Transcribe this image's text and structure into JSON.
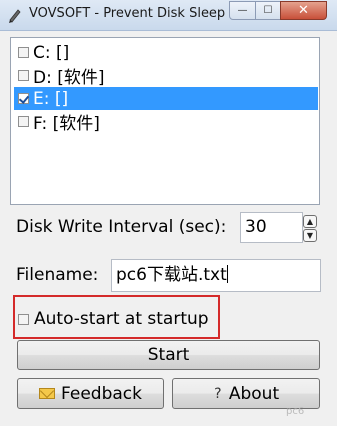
{
  "window": {
    "title": "VOVSOFT - Prevent Disk Sleep"
  },
  "title_controls": {
    "minimize": "—",
    "maximize": "☐",
    "close": "✕"
  },
  "drives": [
    {
      "label": "C: []",
      "checked": false,
      "selected": false
    },
    {
      "label": "D: [软件]",
      "checked": false,
      "selected": false
    },
    {
      "label": "E: []",
      "checked": true,
      "selected": true
    },
    {
      "label": "F: [软件]",
      "checked": false,
      "selected": false
    }
  ],
  "interval": {
    "label": "Disk Write Interval (sec):",
    "value": "30",
    "up": "▲",
    "down": "▼"
  },
  "filename": {
    "label": "Filename:",
    "value": "pc6下载站.txt"
  },
  "autostart": {
    "label": "Auto-start at startup",
    "checked": false
  },
  "buttons": {
    "start": "Start",
    "feedback": "Feedback",
    "about": "About",
    "about_icon": "?"
  },
  "watermark": "pc6"
}
